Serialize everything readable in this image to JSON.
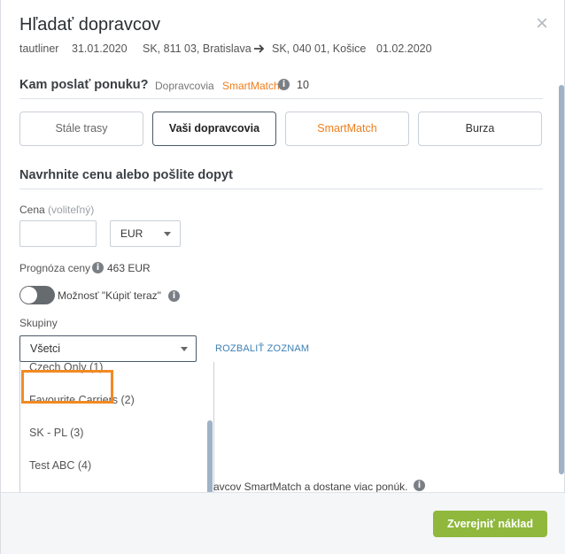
{
  "header": {
    "title": "Hľadať dopravcov",
    "vehicle": "tautliner",
    "date_from": "31.01.2020",
    "origin": "SK, 811 03, Bratislava",
    "destination": "SK, 040 01, Košice",
    "date_to": "01.02.2020"
  },
  "send_offer": {
    "title": "Kam poslať ponuku?",
    "subtitle": "Dopravcovia",
    "smartmatch": "SmartMatch",
    "count": "10"
  },
  "tabs": [
    {
      "label": "Stále trasy"
    },
    {
      "label": "Vaši dopravcovia",
      "active": true
    },
    {
      "label": "SmartMatch"
    },
    {
      "label": "Burza"
    }
  ],
  "price_section": {
    "title": "Navrhnite cenu alebo pošlite dopyt",
    "price_label": "Cena",
    "price_optional": "(voliteľný)",
    "price_value": "",
    "currency": "EUR",
    "forecast_label": "Prognóza ceny",
    "forecast_value": "463 EUR",
    "buy_now_label": "Možnosť \"Kúpiť teraz\"",
    "buy_now_enabled": false
  },
  "groups": {
    "label": "Skupiny",
    "selected": "Všetci",
    "expand_link": "ROZBALIŤ ZOZNAM",
    "options": [
      "Czech Only (1)",
      "Favourite Carriers (2)",
      "SK - PL (3)",
      "Test ABC (4)"
    ]
  },
  "note": "avcov SmartMatch a dostane viac ponúk.",
  "footer": {
    "publish_label": "Zverejniť náklad"
  },
  "colors": {
    "accent_orange": "#f07d1a",
    "highlight": "#f28a21",
    "publish_green": "#8fb83c",
    "link_blue": "#3e82b5"
  }
}
